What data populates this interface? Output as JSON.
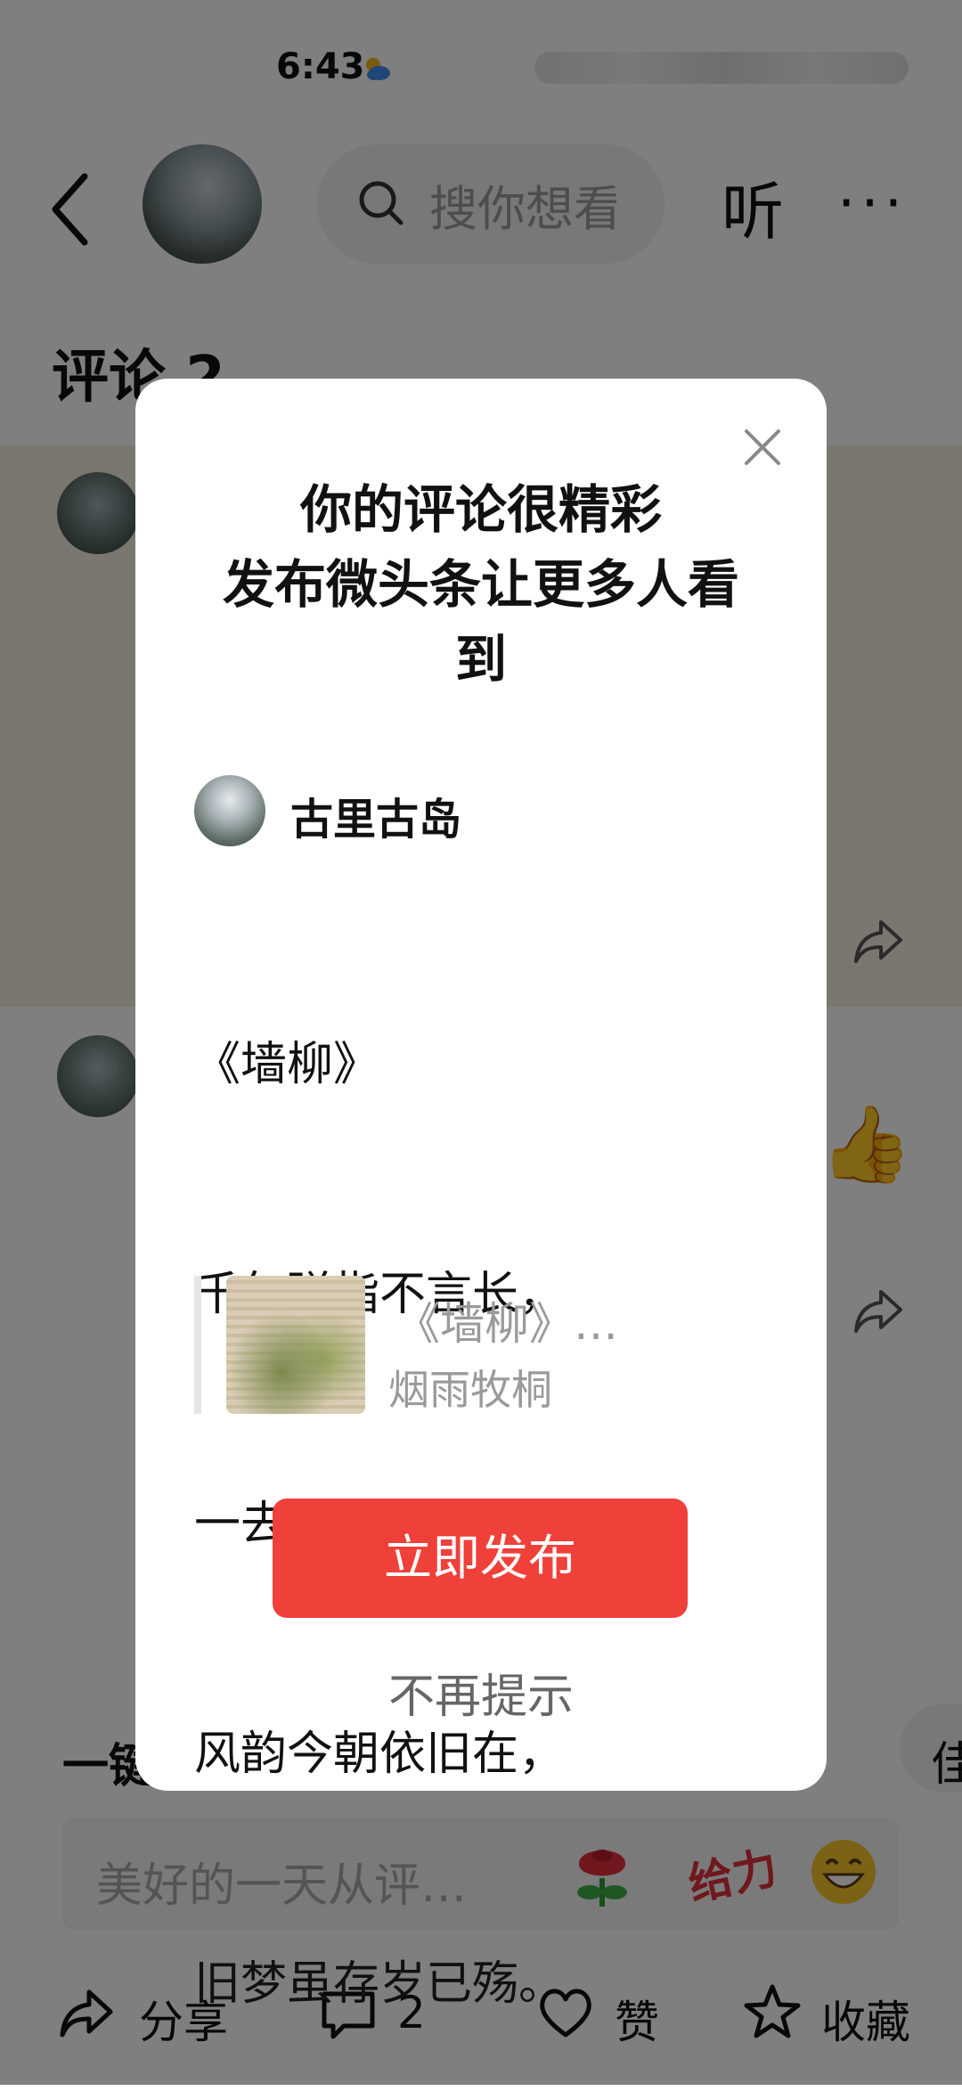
{
  "status_bar": {
    "time": "6:43"
  },
  "header": {
    "search_placeholder": "搜你想看",
    "listen_label": "听",
    "more_label": "···"
  },
  "comments": {
    "title": "评论 2"
  },
  "footer": {
    "one_click_label": "一键",
    "right_pill_label": "佳",
    "input_placeholder": "美好的一天从评…",
    "geili_label": "给力",
    "share_label": "分享",
    "comment_count": "2",
    "like_label": "赞",
    "favorite_label": "收藏"
  },
  "modal": {
    "title_line1": "你的评论很精彩",
    "title_line2": "发布微头条让更多人看",
    "title_line3": "到",
    "author_name": "古里古岛",
    "poem_lines": [
      "《墙柳》",
      "千年弹指不言长，",
      "一去深宫立浅墙。",
      "风韵今朝依旧在，",
      "旧梦虽存岁已殇。"
    ],
    "quote_title": "《墙柳》…",
    "quote_author": "烟雨牧桐",
    "publish_label": "立即发布",
    "no_remind_label": "不再提示"
  },
  "colors": {
    "accent_red": "#f0403a",
    "overlay": "rgba(0,0,0,0.5)"
  }
}
